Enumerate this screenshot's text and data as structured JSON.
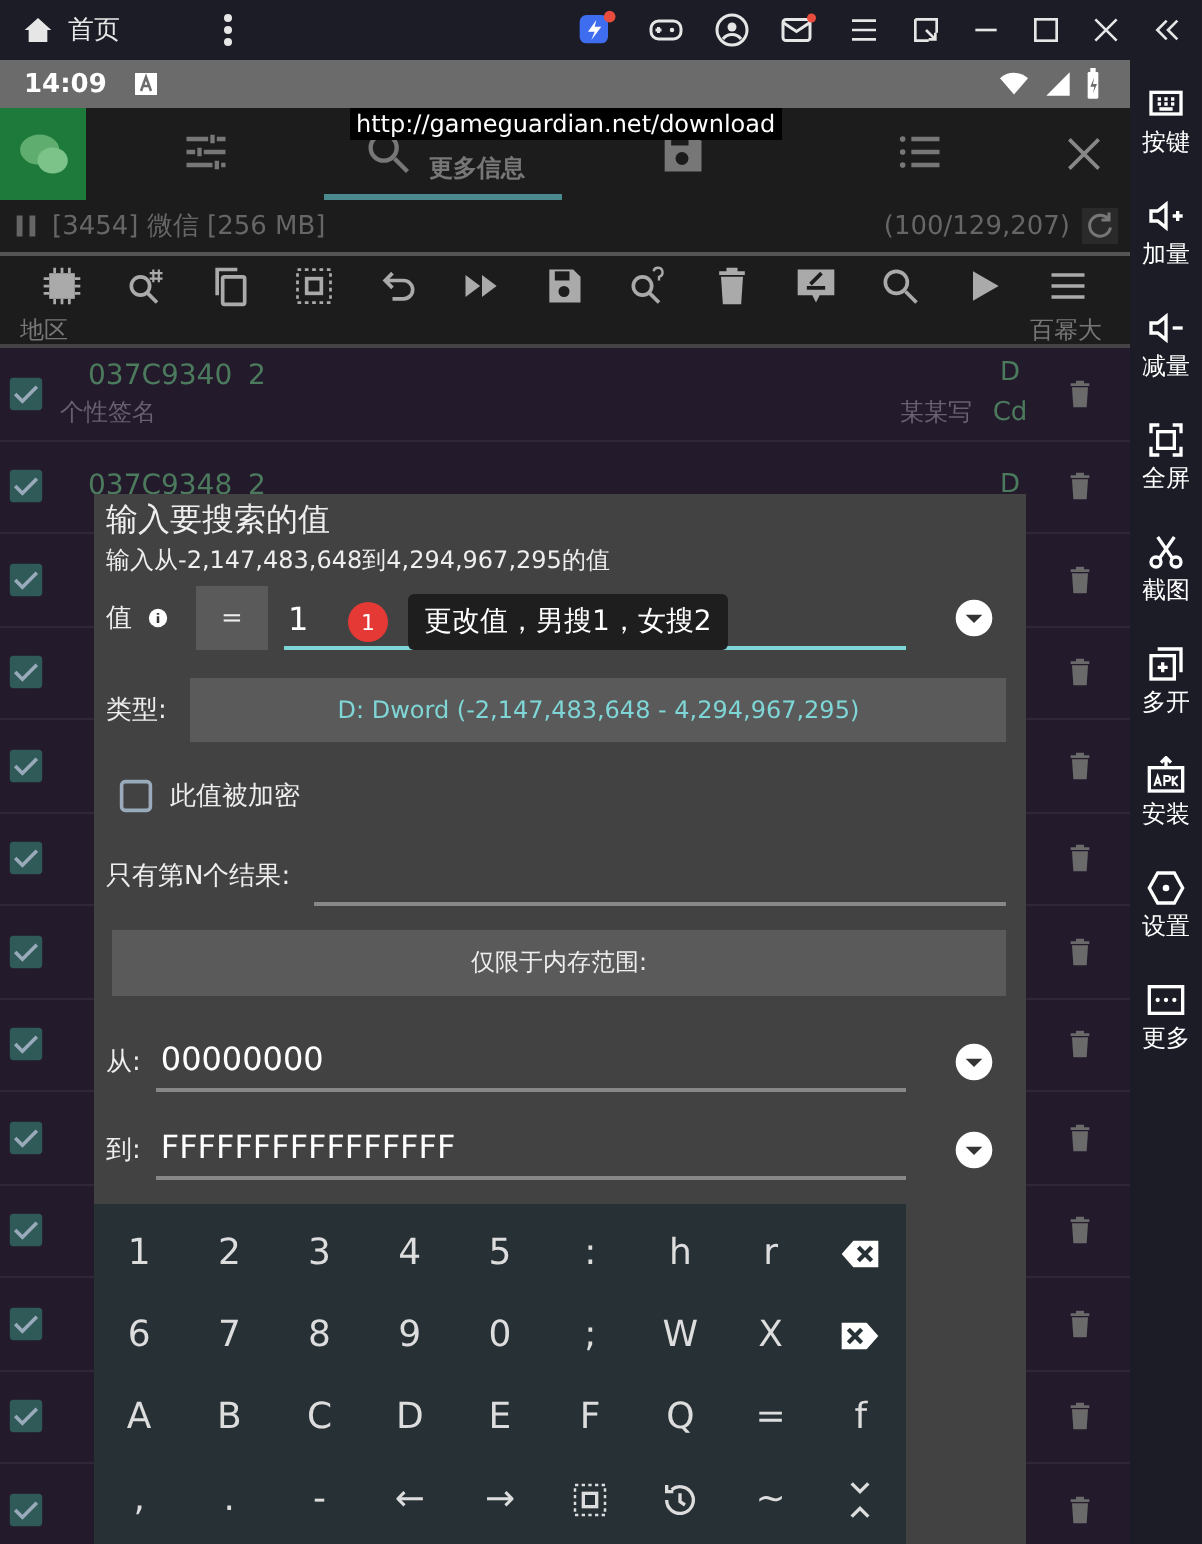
{
  "emulator_bar": {
    "home_label": "首页"
  },
  "status_bar": {
    "time": "14:09"
  },
  "gg_header": {
    "tabs": [
      {
        "kind": "tools",
        "selected": false
      },
      {
        "kind": "search",
        "selected": true,
        "label": "更多信息"
      },
      {
        "kind": "save",
        "selected": false
      },
      {
        "kind": "list",
        "selected": false
      }
    ],
    "tooltip": "http://gameguardian.net/download"
  },
  "process": {
    "label": "[3454] 微信 [256 MB]",
    "count": "(100/129,207)"
  },
  "columns": {
    "column_1": "地区",
    "column_2": "百幂大"
  },
  "rows": [
    {
      "checked": true,
      "address": "037C9340",
      "value": "2",
      "type": "D",
      "type_2": "Cd",
      "note": "个性签名",
      "note_2": "某某写"
    },
    {
      "checked": true,
      "address": "037C9348",
      "value": "2",
      "type": "D"
    },
    {
      "checked": true
    },
    {
      "checked": true
    },
    {
      "checked": true
    },
    {
      "checked": true
    },
    {
      "checked": true
    },
    {
      "checked": true
    },
    {
      "checked": true
    },
    {
      "checked": true
    },
    {
      "checked": true
    },
    {
      "checked": true
    },
    {
      "checked": true
    }
  ],
  "dialog": {
    "title": "输入要搜索的值",
    "subtitle": "输入从-2,147,483,648到4,294,967,295的值",
    "value_label": "值",
    "operator": "=",
    "value": "1",
    "hint_badge": "1",
    "hint": "更改值，男搜1，女搜2",
    "type_label": "类型:",
    "type_value": "D: Dword (-2,147,483,648 - 4,294,967,295)",
    "encrypted": {
      "label": "此值被加密",
      "checked": false
    },
    "nth_label": "只有第N个结果:",
    "range_button": "仅限于内存范围:",
    "from_label": "从:",
    "from_value": "00000000",
    "to_label": "到:",
    "to_value": "FFFFFFFFFFFFFFFF"
  },
  "keyboard": {
    "rows": [
      [
        {
          "kind": "char",
          "label": "1"
        },
        {
          "kind": "char",
          "label": "2"
        },
        {
          "kind": "char",
          "label": "3"
        },
        {
          "kind": "char",
          "label": "4"
        },
        {
          "kind": "char",
          "label": "5"
        },
        {
          "kind": "char",
          "label": ":"
        },
        {
          "kind": "char",
          "label": "h"
        },
        {
          "kind": "char",
          "label": "r"
        },
        {
          "kind": "backspace"
        }
      ],
      [
        {
          "kind": "char",
          "label": "6"
        },
        {
          "kind": "char",
          "label": "7"
        },
        {
          "kind": "char",
          "label": "8"
        },
        {
          "kind": "char",
          "label": "9"
        },
        {
          "kind": "char",
          "label": "0"
        },
        {
          "kind": "char",
          "label": ";"
        },
        {
          "kind": "char",
          "label": "W"
        },
        {
          "kind": "char",
          "label": "X"
        },
        {
          "kind": "delete"
        }
      ],
      [
        {
          "kind": "char",
          "label": "A"
        },
        {
          "kind": "char",
          "label": "B"
        },
        {
          "kind": "char",
          "label": "C"
        },
        {
          "kind": "char",
          "label": "D"
        },
        {
          "kind": "char",
          "label": "E"
        },
        {
          "kind": "char",
          "label": "F"
        },
        {
          "kind": "char",
          "label": "Q"
        },
        {
          "kind": "char",
          "label": "="
        },
        {
          "kind": "char",
          "label": "f"
        }
      ],
      [
        {
          "kind": "char",
          "label": ","
        },
        {
          "kind": "char",
          "label": "."
        },
        {
          "kind": "char",
          "label": "-"
        },
        {
          "kind": "char",
          "label": "←"
        },
        {
          "kind": "char",
          "label": "→"
        },
        {
          "kind": "select"
        },
        {
          "kind": "history"
        },
        {
          "kind": "char",
          "label": "~"
        },
        {
          "kind": "collapse"
        }
      ]
    ]
  },
  "sidebar": {
    "items": [
      {
        "kind": "keyboard",
        "label": "按键"
      },
      {
        "kind": "volume_up",
        "label": "加量"
      },
      {
        "kind": "volume_down",
        "label": "减量"
      },
      {
        "kind": "fullscreen",
        "label": "全屏"
      },
      {
        "kind": "screenshot",
        "label": "截图"
      },
      {
        "kind": "multi",
        "label": "多开"
      },
      {
        "kind": "apk",
        "label": "安装"
      },
      {
        "kind": "settings",
        "label": "设置"
      },
      {
        "kind": "more",
        "label": "更多"
      }
    ]
  }
}
